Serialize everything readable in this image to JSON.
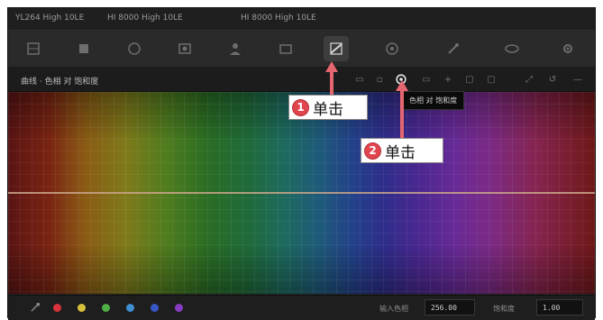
{
  "titlebar": {
    "left": "YL264 High 10LE",
    "mid": "HI 8000 High 10LE",
    "right": "HI 8000 High 10LE"
  },
  "subbar": {
    "mode_label": "曲线 · 色相 对 饱和度"
  },
  "tooltip": {
    "text": "色相 对 饱和度"
  },
  "bottombar": {
    "input_label": "输入色相",
    "input_value": "256.00",
    "sat_label": "饱和度",
    "sat_value": "1.00"
  },
  "annotations": [
    {
      "number": "1",
      "text": "单击"
    },
    {
      "number": "2",
      "text": "单击"
    }
  ],
  "toolbar_icons": [
    "grid-icon",
    "square-icon",
    "circle-icon",
    "window-icon",
    "person-icon",
    "box-icon",
    "curves-icon",
    "target-icon",
    "picker-icon",
    "shape-icon",
    "gear-icon"
  ],
  "swatch_colors": [
    "#d9343c",
    "#d8c13a",
    "#4fae45",
    "#3f8fd3",
    "#3857c8",
    "#8a3bc4"
  ],
  "accent": {
    "callout_red": "#e0454e"
  }
}
